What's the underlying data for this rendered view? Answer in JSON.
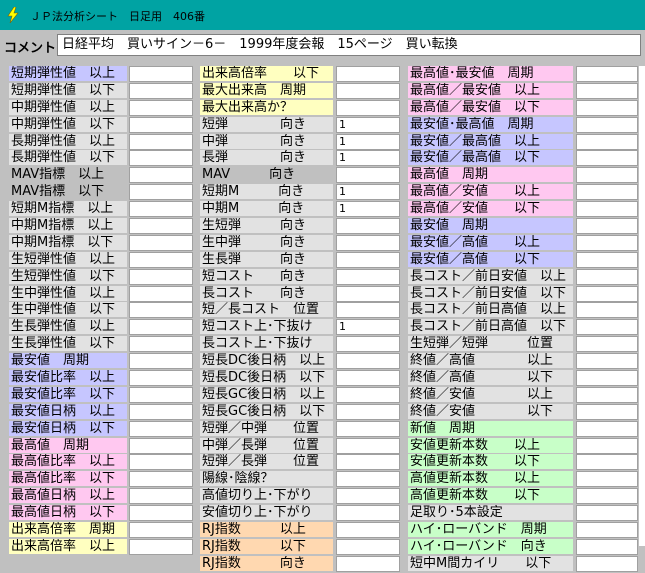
{
  "window": {
    "title": "ＪＰ法分析シート　日足用　406番"
  },
  "comment": {
    "label": "コメント",
    "text": "日経平均　買いサイン－6－　1999年度会報　15ページ　買い転換"
  },
  "columns": [
    {
      "rows": [
        {
          "label": "短期弾性値　以上",
          "bg": "b",
          "value": ""
        },
        {
          "label": "短期弾性値　以下",
          "bg": "s",
          "value": ""
        },
        {
          "label": "中期弾性値　以上",
          "bg": "s",
          "value": ""
        },
        {
          "label": "中期弾性値　以下",
          "bg": "s",
          "value": ""
        },
        {
          "label": "長期弾性値　以上",
          "bg": "s",
          "value": ""
        },
        {
          "label": "長期弾性値　以下",
          "bg": "s",
          "value": ""
        },
        {
          "label": "MAV指標　以上",
          "bg": "n",
          "value": ""
        },
        {
          "label": "MAV指標　以下",
          "bg": "n",
          "value": ""
        },
        {
          "label": "短期M指標　以上",
          "bg": "s",
          "value": ""
        },
        {
          "label": "中期M指標　以上",
          "bg": "s",
          "value": ""
        },
        {
          "label": "中期M指標　以下",
          "bg": "s",
          "value": ""
        },
        {
          "label": "生短弾性値　以上",
          "bg": "s",
          "value": ""
        },
        {
          "label": "生短弾性値　以下",
          "bg": "s",
          "value": ""
        },
        {
          "label": "生中弾性値　以上",
          "bg": "s",
          "value": ""
        },
        {
          "label": "生中弾性値　以下",
          "bg": "s",
          "value": ""
        },
        {
          "label": "生長弾性値　以上",
          "bg": "s",
          "value": ""
        },
        {
          "label": "生長弾性値　以下",
          "bg": "s",
          "value": ""
        },
        {
          "label": "最安値　周期",
          "bg": "b",
          "value": ""
        },
        {
          "label": "最安値比率　以上",
          "bg": "b",
          "value": ""
        },
        {
          "label": "最安値比率　以下",
          "bg": "b",
          "value": ""
        },
        {
          "label": "最安値日柄　以上",
          "bg": "b",
          "value": ""
        },
        {
          "label": "最安値日柄　以下",
          "bg": "b",
          "value": ""
        },
        {
          "label": "最高値　周期",
          "bg": "p",
          "value": ""
        },
        {
          "label": "最高値比率　以上",
          "bg": "p",
          "value": ""
        },
        {
          "label": "最高値比率　以下",
          "bg": "p",
          "value": ""
        },
        {
          "label": "最高値日柄　以上",
          "bg": "p",
          "value": ""
        },
        {
          "label": "最高値日柄　以下",
          "bg": "p",
          "value": ""
        },
        {
          "label": "出来高倍率　周期",
          "bg": "y",
          "value": ""
        },
        {
          "label": "出来高倍率　以上",
          "bg": "y",
          "value": ""
        }
      ]
    },
    {
      "rows": [
        {
          "label": "出来高倍率　　以下",
          "bg": "y",
          "value": ""
        },
        {
          "label": "最大出来高　周期",
          "bg": "y",
          "value": ""
        },
        {
          "label": "最大出来高か？",
          "bg": "y",
          "value": ""
        },
        {
          "label": "短弾　　　　向き",
          "bg": "s",
          "value": "1"
        },
        {
          "label": "中弾　　　　向き",
          "bg": "s",
          "value": "1"
        },
        {
          "label": "長弾　　　　向き",
          "bg": "s",
          "value": "1"
        },
        {
          "label": "MAV　　　向き",
          "bg": "n",
          "value": ""
        },
        {
          "label": "短期M　　　向き",
          "bg": "s",
          "value": "1"
        },
        {
          "label": "中期M　　　向き",
          "bg": "s",
          "value": "1"
        },
        {
          "label": "生短弾　　　向き",
          "bg": "s",
          "value": ""
        },
        {
          "label": "生中弾　　　向き",
          "bg": "s",
          "value": ""
        },
        {
          "label": "生長弾　　　向き",
          "bg": "s",
          "value": ""
        },
        {
          "label": "短コスト　　向き",
          "bg": "s",
          "value": ""
        },
        {
          "label": "長コスト　　向き",
          "bg": "s",
          "value": ""
        },
        {
          "label": "短／長コスト　位置",
          "bg": "s",
          "value": ""
        },
        {
          "label": "短コスト上･下抜け",
          "bg": "s",
          "value": "1"
        },
        {
          "label": "長コスト上･下抜け",
          "bg": "s",
          "value": ""
        },
        {
          "label": "短長DC後日柄　以上",
          "bg": "s",
          "value": ""
        },
        {
          "label": "短長DC後日柄　以下",
          "bg": "s",
          "value": ""
        },
        {
          "label": "短長GC後日柄　以上",
          "bg": "s",
          "value": ""
        },
        {
          "label": "短長GC後日柄　以下",
          "bg": "s",
          "value": ""
        },
        {
          "label": "短弾／中弾　　位置",
          "bg": "s",
          "value": ""
        },
        {
          "label": "中弾／長弾　　位置",
          "bg": "s",
          "value": ""
        },
        {
          "label": "短弾／長弾　　位置",
          "bg": "s",
          "value": ""
        },
        {
          "label": "陽線･陰線？",
          "bg": "s",
          "value": ""
        },
        {
          "label": "高値切り上･下がり",
          "bg": "s",
          "value": ""
        },
        {
          "label": "安値切り上･下がり",
          "bg": "s",
          "value": ""
        },
        {
          "label": "RJ指数　　　以上",
          "bg": "o",
          "value": ""
        },
        {
          "label": "RJ指数　　　以下",
          "bg": "o",
          "value": ""
        },
        {
          "label": "RJ指数　　　向き",
          "bg": "o",
          "value": ""
        }
      ]
    },
    {
      "rows": [
        {
          "label": "最高値･最安値　周期",
          "bg": "p",
          "value": ""
        },
        {
          "label": "最高値／最安値　以上",
          "bg": "p",
          "value": ""
        },
        {
          "label": "最高値／最安値　以下",
          "bg": "p",
          "value": ""
        },
        {
          "label": "最安値･最高値　周期",
          "bg": "b",
          "value": ""
        },
        {
          "label": "最安値／最高値　以上",
          "bg": "b",
          "value": ""
        },
        {
          "label": "最安値／最高値　以下",
          "bg": "b",
          "value": ""
        },
        {
          "label": "最高値　周期",
          "bg": "p",
          "value": ""
        },
        {
          "label": "最高値／安値　　以上",
          "bg": "p",
          "value": ""
        },
        {
          "label": "最高値／安値　　以下",
          "bg": "p",
          "value": ""
        },
        {
          "label": "最安値　周期",
          "bg": "b",
          "value": ""
        },
        {
          "label": "最安値／高値　　以上",
          "bg": "b",
          "value": ""
        },
        {
          "label": "最安値／高値　　以下",
          "bg": "b",
          "value": ""
        },
        {
          "label": "長コスト／前日安値　以上",
          "bg": "s",
          "value": ""
        },
        {
          "label": "長コスト／前日安値　以下",
          "bg": "s",
          "value": ""
        },
        {
          "label": "長コスト／前日高値　以上",
          "bg": "s",
          "value": ""
        },
        {
          "label": "長コスト／前日高値　以下",
          "bg": "s",
          "value": ""
        },
        {
          "label": "生短弾／短弾　　　位置",
          "bg": "s",
          "value": ""
        },
        {
          "label": "終値／高値　　　　以上",
          "bg": "s",
          "value": ""
        },
        {
          "label": "終値／高値　　　　以下",
          "bg": "s",
          "value": ""
        },
        {
          "label": "終値／安値　　　　以上",
          "bg": "s",
          "value": ""
        },
        {
          "label": "終値／安値　　　　以下",
          "bg": "s",
          "value": ""
        },
        {
          "label": "新値　周期",
          "bg": "g",
          "value": ""
        },
        {
          "label": "安値更新本数　　以上",
          "bg": "g",
          "value": ""
        },
        {
          "label": "安値更新本数　　以下",
          "bg": "g",
          "value": ""
        },
        {
          "label": "高値更新本数　　以上",
          "bg": "g",
          "value": ""
        },
        {
          "label": "高値更新本数　　以下",
          "bg": "g",
          "value": ""
        },
        {
          "label": "足取り･5本設定",
          "bg": "s",
          "value": ""
        },
        {
          "label": "ハイ･ローバンド　周期",
          "bg": "g",
          "value": ""
        },
        {
          "label": "ハイ･ローバンド　向き",
          "bg": "g",
          "value": ""
        },
        {
          "label": "短中M間カイリ　　以下",
          "bg": "s",
          "value": ""
        }
      ]
    }
  ]
}
